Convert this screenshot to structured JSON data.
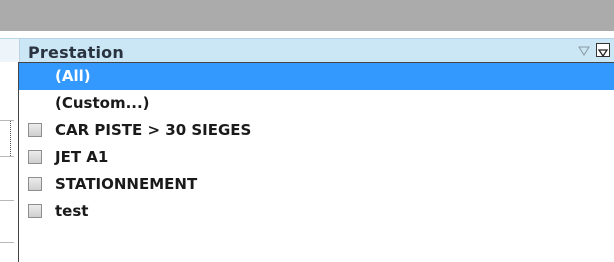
{
  "column": {
    "header_label": "Prestation",
    "sort_icon": "sort-triangle-icon",
    "filter_icon": "filter-dropdown-icon"
  },
  "filter_list": {
    "items": [
      {
        "label": "(All)",
        "checkbox": false,
        "selected": true
      },
      {
        "label": "(Custom...)",
        "checkbox": false,
        "selected": false
      },
      {
        "label": "CAR PISTE > 30 SIEGES",
        "checkbox": true,
        "checked": false
      },
      {
        "label": "JET A1",
        "checkbox": true,
        "checked": false
      },
      {
        "label": "STATIONNEMENT",
        "checkbox": true,
        "checked": false
      },
      {
        "label": "test",
        "checkbox": true,
        "checked": false
      }
    ]
  },
  "colors": {
    "selection": "#3399ff",
    "header_bg": "#cbe6f4",
    "top_bar": "#ababab"
  }
}
